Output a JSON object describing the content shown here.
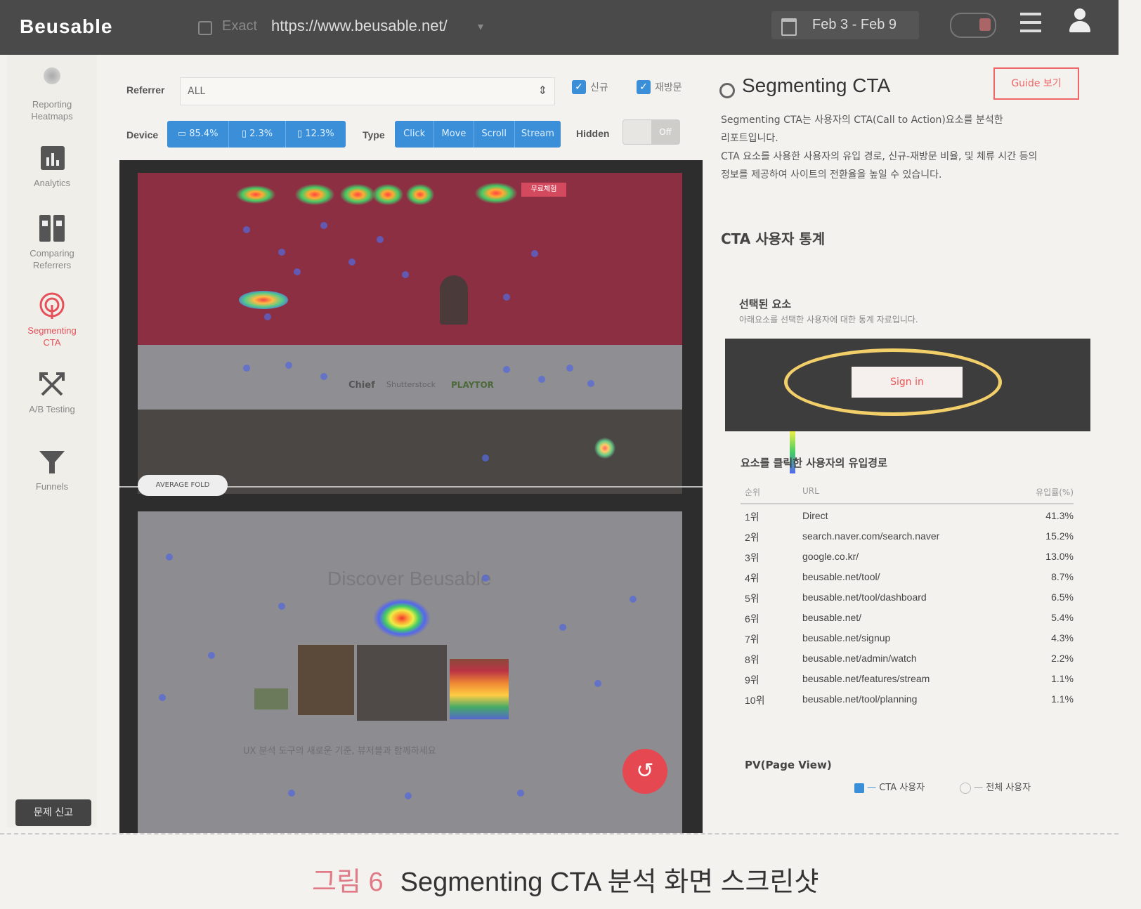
{
  "topbar": {
    "logo": "Beusable",
    "url_mode": "Exact",
    "url": "https://www.beusable.net/",
    "date_range": "Feb 3 - Feb 9"
  },
  "sidebar": {
    "items": [
      {
        "label": "Reporting Heatmaps",
        "icon": "heatmap-icon"
      },
      {
        "label": "Analytics",
        "icon": "bar-chart-icon"
      },
      {
        "label": "Comparing Referrers",
        "icon": "compare-icon"
      },
      {
        "label": "Segmenting CTA",
        "icon": "target-icon",
        "active": true
      },
      {
        "label": "A/B Testing",
        "icon": "split-arrows-icon"
      },
      {
        "label": "Funnels",
        "icon": "funnel-icon"
      }
    ],
    "report_button": "문제 신고"
  },
  "controls": {
    "referrer_label": "Referrer",
    "referrer_value": "ALL",
    "new_user_label": "신규",
    "returning_user_label": "재방문",
    "device_label": "Device",
    "devices": [
      "85.4%",
      "2.3%",
      "12.3%"
    ],
    "type_label": "Type",
    "types": [
      "Click",
      "Move",
      "Scroll",
      "Stream"
    ],
    "hidden_label": "Hidden",
    "hidden_value": "Off"
  },
  "preview": {
    "fold_label": "AVERAGE FOLD",
    "hero_button": "무료체험",
    "logos": [
      "Chief",
      "Shutterstock",
      "PLAYTOR"
    ],
    "lower_title": "Discover Beusable",
    "lower_desc": "UX 분석 도구의 새로운 기준, 뷰저블과 함께하세요"
  },
  "panel": {
    "title": "Segmenting CTA",
    "guide_button": "Guide 보기",
    "description": [
      "Segmenting CTA는 사용자의 CTA(Call to Action)요소를 분석한",
      "리포트입니다.",
      "CTA 요소를 사용한 사용자의 유입 경로, 신규-재방문 비율, 및 체류 시간 등의",
      "정보를 제공하여 사이트의 전환율을 높일 수 있습니다."
    ],
    "stats_title": "CTA 사용자 통계",
    "selected_title": "선택된 요소",
    "selected_sub": "아래요소를 선택한 사용자에 대한 통계 자료입니다.",
    "cta_button": "Sign in",
    "paths_title": "요소를 클릭한 사용자의 유입경로",
    "table_headers": {
      "rank": "순위",
      "url": "URL",
      "ratio": "유입률(%)"
    },
    "rows": [
      {
        "rank": "1위",
        "url": "Direct",
        "pct": "41.3%"
      },
      {
        "rank": "2위",
        "url": "search.naver.com/search.naver",
        "pct": "15.2%"
      },
      {
        "rank": "3위",
        "url": "google.co.kr/",
        "pct": "13.0%"
      },
      {
        "rank": "4위",
        "url": "beusable.net/tool/",
        "pct": "8.7%"
      },
      {
        "rank": "5위",
        "url": "beusable.net/tool/dashboard",
        "pct": "6.5%"
      },
      {
        "rank": "6위",
        "url": "beusable.net/",
        "pct": "5.4%"
      },
      {
        "rank": "7위",
        "url": "beusable.net/signup",
        "pct": "4.3%"
      },
      {
        "rank": "8위",
        "url": "beusable.net/admin/watch",
        "pct": "2.2%"
      },
      {
        "rank": "9위",
        "url": "beusable.net/features/stream",
        "pct": "1.1%"
      },
      {
        "rank": "10위",
        "url": "beusable.net/tool/planning",
        "pct": "1.1%"
      }
    ],
    "pv_label": "PV(Page View)",
    "legend_cta": "CTA 사용자",
    "legend_all": "전체 사용자"
  },
  "caption": {
    "number": "그림 6",
    "text": "Segmenting CTA 분석 화면 스크린샷"
  },
  "colors": {
    "accent": "#3a8fd8",
    "active": "#e6505a",
    "highlight": "#f3cf6a"
  }
}
